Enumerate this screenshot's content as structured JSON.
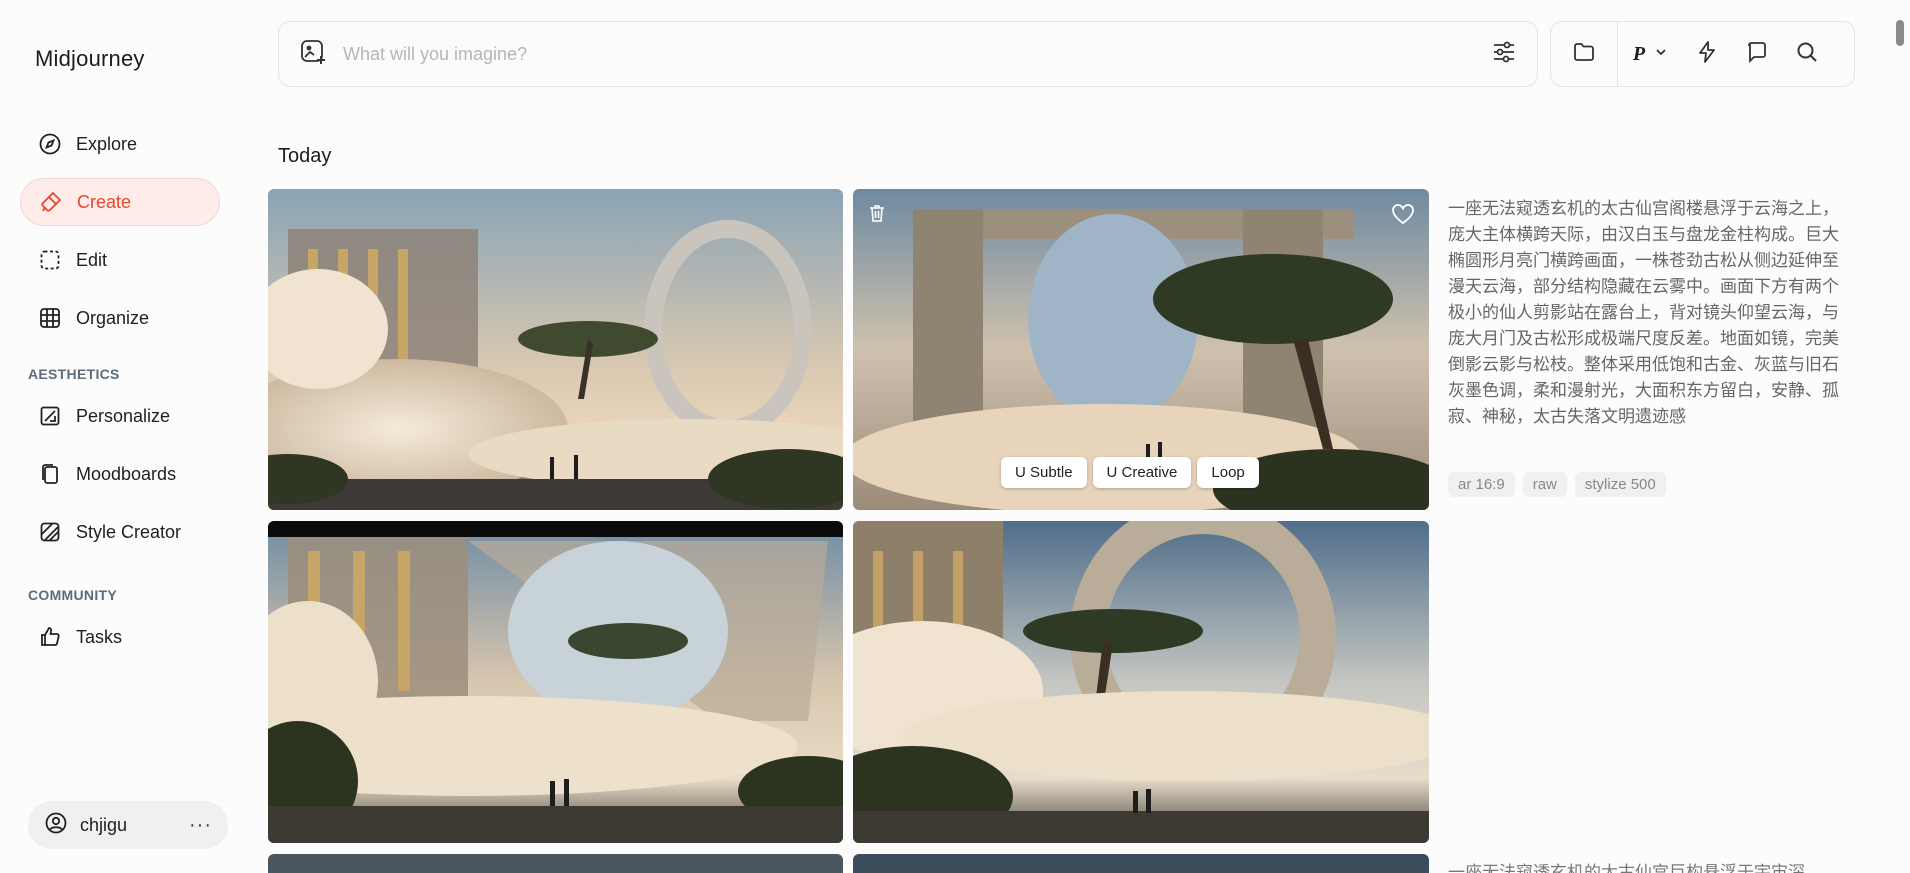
{
  "app": {
    "title": "Midjourney"
  },
  "sidebar": {
    "items": [
      {
        "label": "Explore",
        "icon": "compass-icon"
      },
      {
        "label": "Create",
        "icon": "brush-icon"
      },
      {
        "label": "Edit",
        "icon": "edit-icon"
      },
      {
        "label": "Organize",
        "icon": "grid-icon"
      }
    ],
    "aesthetics_label": "AESTHETICS",
    "aesthetics_items": [
      {
        "label": "Personalize",
        "icon": "personalize-icon"
      },
      {
        "label": "Moodboards",
        "icon": "moodboards-icon"
      },
      {
        "label": "Style Creator",
        "icon": "style-creator-icon"
      }
    ],
    "community_label": "COMMUNITY",
    "community_items": [
      {
        "label": "Tasks",
        "icon": "thumbs-up-icon"
      }
    ],
    "user": {
      "name": "chjigu",
      "more": "···"
    }
  },
  "search": {
    "placeholder": "What will you imagine?"
  },
  "toolbar": {
    "profile_letter": "P"
  },
  "main": {
    "heading": "Today",
    "prompt": "一座无法窥透玄机的太古仙宫阁楼悬浮于云海之上，庞大主体横跨天际，由汉白玉与盘龙金柱构成。巨大椭圆形月亮门横跨画面，一株苍劲古松从侧边延伸至漫天云海，部分结构隐藏在云雾中。画面下方有两个极小的仙人剪影站在露台上，背对镜头仰望云海，与庞大月门及古松形成极端尺度反差。地面如镜，完美倒影云影与松枝。整体采用低饱和古金、灰蓝与旧石灰墨色调，柔和漫射光，大面积东方留白，安静、孤寂、神秘，太古失落文明遗迹感",
    "tags": [
      "ar 16:9",
      "raw",
      "stylize 500"
    ],
    "overlay_buttons": [
      "U Subtle",
      "U Creative",
      "Loop"
    ],
    "prompt2": "一座无法窥透玄机的太古仙宫巨构悬浮于宇宙深"
  },
  "colors": {
    "accent": "#e24a2f",
    "active_bg": "#fdecea"
  }
}
